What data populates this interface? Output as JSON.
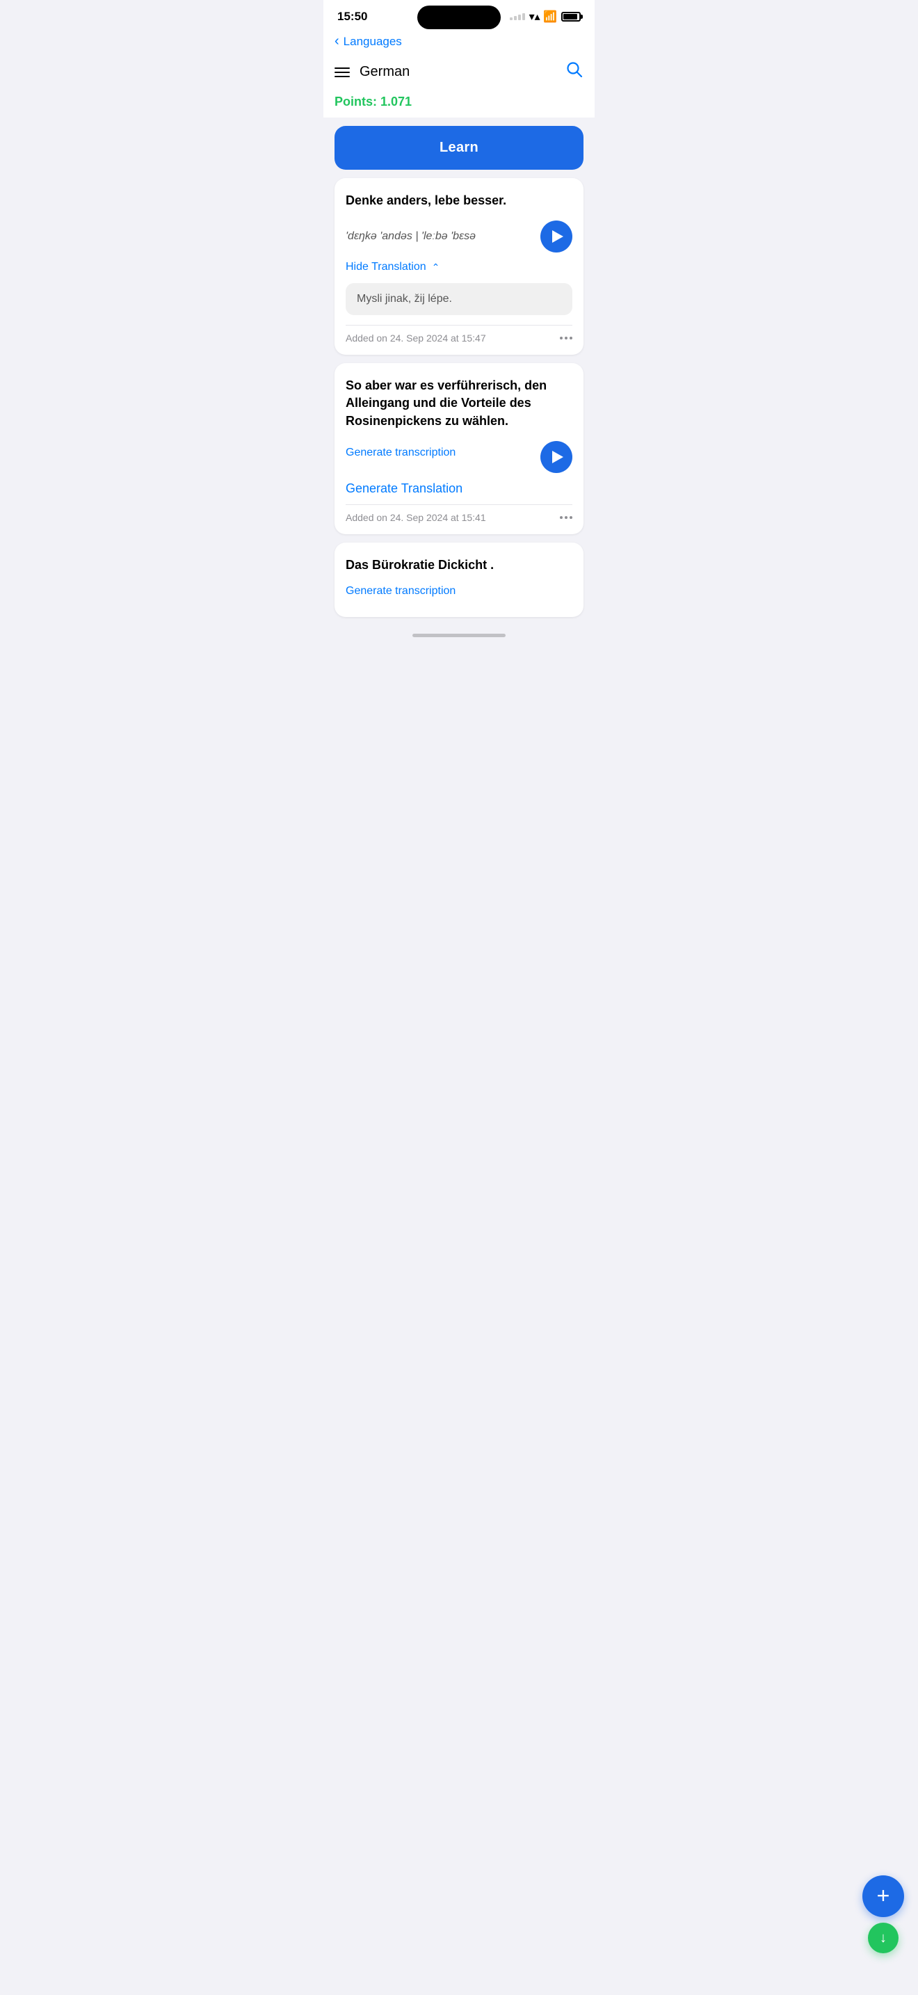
{
  "statusBar": {
    "time": "15:50",
    "wifi": "wifi",
    "battery": "battery"
  },
  "nav": {
    "backLabel": "Languages"
  },
  "header": {
    "title": "German",
    "menuIcon": "menu",
    "searchIcon": "search"
  },
  "points": {
    "label": "Points:",
    "value": "1.071"
  },
  "learnButton": {
    "label": "Learn"
  },
  "cards": [
    {
      "id": "card-1",
      "phrase": "Denke anders, lebe besser.",
      "phonetic": "'dɛŋkə 'andəs | 'leːbə 'bɛsə",
      "hideTranslationLabel": "Hide Translation",
      "translation": "Mysli jinak, žij lépe.",
      "addedDate": "Added on 24. Sep 2024 at 15:47",
      "hasTranslation": true
    },
    {
      "id": "card-2",
      "phrase": "So aber war es verführerisch, den Alleingang und die Vorteile des Rosinenpickens zu wählen.",
      "phonetic": null,
      "generateTranscriptionLabel": "Generate transcription",
      "generateTranslationLabel": "Generate Translation",
      "addedDate": "Added on 24. Sep 2024 at 15:41",
      "hasTranslation": false
    },
    {
      "id": "card-3",
      "phrase": "Das Bürokratie Dickicht .",
      "phonetic": null,
      "generateTranscriptionLabel": "Generate transcription",
      "hasTranslation": false
    }
  ],
  "fab": {
    "addLabel": "+",
    "downLabel": "↓"
  }
}
